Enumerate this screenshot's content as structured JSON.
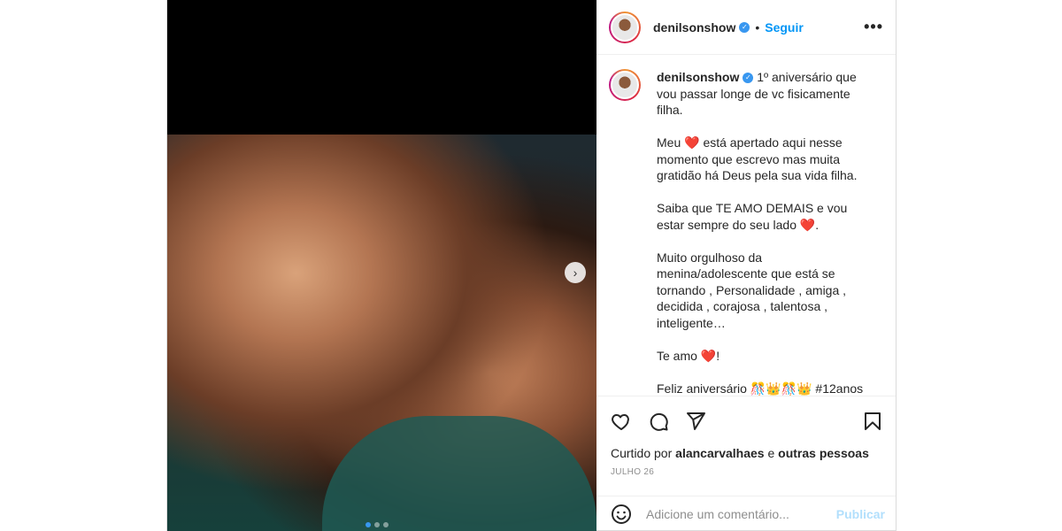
{
  "post": {
    "username": "denilsonshow",
    "verified_icon": "verified-badge-icon",
    "follow_separator": "•",
    "follow_label": "Seguir",
    "more_label": "•••",
    "next_icon": "›",
    "carousel": {
      "count": 3,
      "active_index": 0
    }
  },
  "caption": {
    "username": "denilsonshow",
    "paragraphs": [
      "1º aniversário que vou passar longe de vc fisicamente filha.",
      "Meu ❤️ está apertado aqui nesse momento que escrevo mas muita gratidão há Deus pela sua vida filha.",
      "Saiba que TE AMO DEMAIS e vou estar sempre do seu lado ❤️.",
      "Muito orgulhoso da menina/adolescente que está se tornando , Personalidade , amiga , decidida , corajosa , talentosa , inteligente…",
      "Te amo ❤️!",
      "Feliz aniversário 🎊👑🎊👑 #12anos"
    ]
  },
  "actions": {
    "like_icon": "heart-icon",
    "comment_icon": "comment-icon",
    "share_icon": "send-icon",
    "save_icon": "bookmark-icon"
  },
  "likes": {
    "prefix": "Curtido por",
    "user": "alancarvalhaes",
    "connector": "e",
    "others": "outras pessoas"
  },
  "date": "JULHO 26",
  "comment": {
    "emoji_icon": "smiley-icon",
    "placeholder": "Adicione um comentário...",
    "publish_label": "Publicar"
  },
  "colors": {
    "accent": "#0095f6",
    "publish_disabled": "#b2dffc",
    "heart": "#e0162b"
  }
}
